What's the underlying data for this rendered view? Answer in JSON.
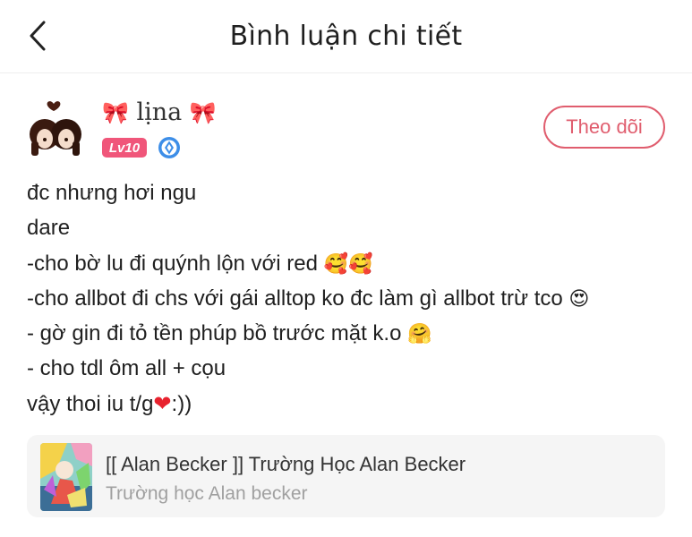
{
  "header": {
    "title": "Bình luận chi tiết",
    "back_icon": "chevron-left-icon"
  },
  "author": {
    "name": "lịna",
    "name_decoration": "🎀",
    "level": "Lv10",
    "rank_icon": "rank-badge-icon",
    "follow_label": "Theo dõi"
  },
  "comment": {
    "lines": [
      {
        "text": "đc nhưng hơi ngu"
      },
      {
        "text": "dare"
      },
      {
        "text": "-cho bờ lu đi quýnh lộn với red ",
        "emoji": "🥰🥰"
      },
      {
        "text": "-cho allbot đi chs với gái alltop ko đc làm gì allbot trừ tco ",
        "emoji": "😍"
      },
      {
        "text": "- gờ gin đi tỏ tền phúp bồ trước mặt k.o ",
        "emoji": "🤗"
      },
      {
        "text": "- cho tdl ôm all + cọu"
      },
      {
        "text": "vậy thoi iu t/g",
        "heart": "❤",
        "suffix": ":))"
      }
    ]
  },
  "community_card": {
    "title": "[[ Alan Becker ]] Trường Học Alan Becker",
    "subtitle": "Trường học Alan becker"
  },
  "colors": {
    "accent": "#e05d6e",
    "level_badge": "#f0567a",
    "card_bg": "#f5f5f5"
  }
}
